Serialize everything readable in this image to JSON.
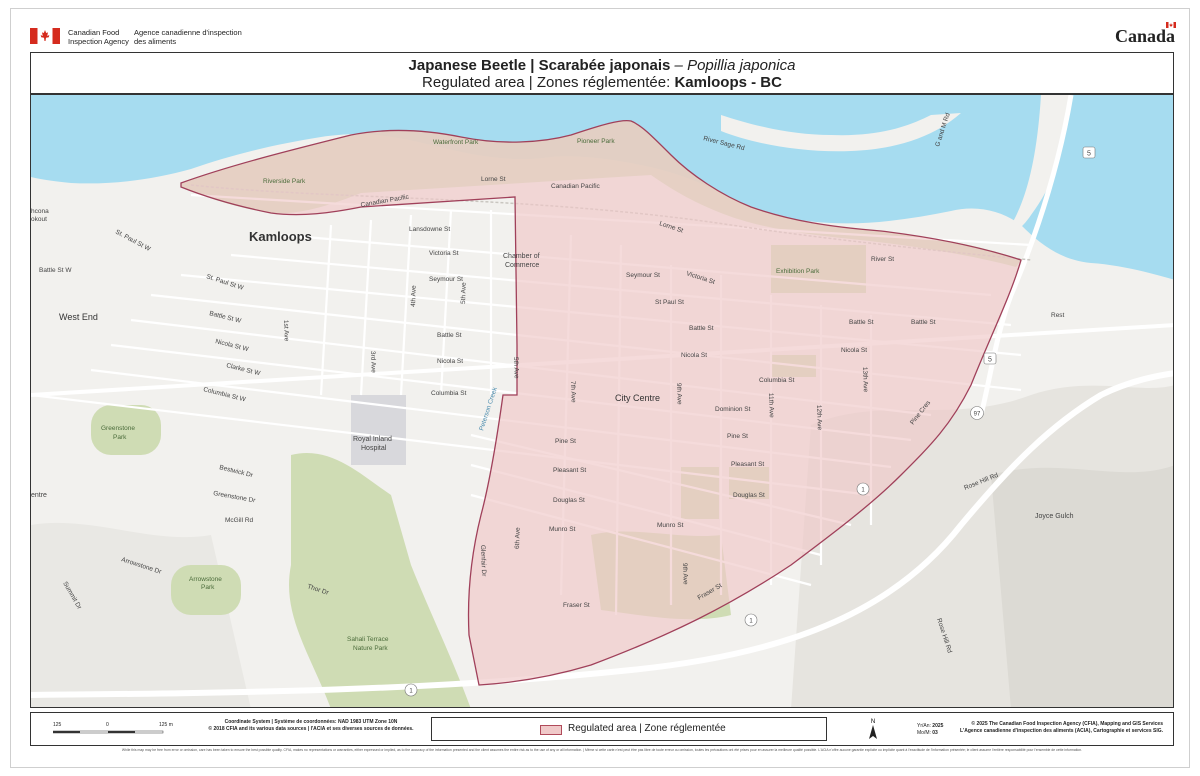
{
  "header": {
    "agency_en": "Canadian Food Inspection Agency",
    "agency_fr": "Agence canadienne d'inspection des aliments",
    "wordmark": "Canada",
    "flag_icon": "canada-flag-icon"
  },
  "title": {
    "common_en": "Japanese Beetle",
    "separator": " | ",
    "common_fr": "Scarabée japonais",
    "dash": " – ",
    "scientific": "Popillia japonica",
    "line2_prefix": "Regulated area | Zones réglementée: ",
    "location": "Kamloops - BC"
  },
  "map": {
    "colors": {
      "water": "#a6dcf0",
      "land": "#f2f1ee",
      "park": "#cfdcb4",
      "regulated_fill": "#f0c8c8",
      "regulated_border": "#a0405a",
      "road": "#ffffff"
    },
    "labels": {
      "city": "Kamloops",
      "west_end": "West End",
      "city_centre": "City Centre",
      "chamber1": "Chamber of",
      "chamber2": "Commerce",
      "hospital1": "Royal Inland",
      "hospital2": "Hospital",
      "joyce": "Joyce Gulch",
      "rest": "Rest",
      "nchcona": "hcona",
      "lookout": "okout",
      "centre_edge": "entre"
    },
    "parks": {
      "riverside": "Riverside Park",
      "waterfront": "Waterfront Park",
      "pioneer": "Pioneer Park",
      "exhibition": "Exhibition Park",
      "greenstone1": "Greenstone",
      "greenstone2": "Park",
      "arrowstone1": "Arrowstone",
      "arrowstone2": "Park",
      "sahali1": "Sahali Terrace",
      "sahali2": "Nature Park"
    },
    "streets": {
      "lorne": "Lorne St",
      "lorne2": "Lorne St",
      "cp1": "Canadian Pacific",
      "cp2": "Canadian Pacific",
      "lansdowne": "Lansdowne St",
      "victoria": "Victoria St",
      "victoria2": "Victoria St",
      "seymour": "Seymour St",
      "seymour2": "Seymour St",
      "stpaul": "St Paul St",
      "stpaul_w": "St. Paul St W",
      "stpaul_w2": "St. Paul St W",
      "battle": "Battle St",
      "battle2": "Battle St",
      "battle3": "Battle St",
      "battle4": "Battle St",
      "battle_w": "Battle St W",
      "battle_w2": "Battle St W",
      "nicola": "Nicola St",
      "nicola2": "Nicola St",
      "nicola3": "Nicola St",
      "nicola_w": "Nicola St W",
      "clarke": "Clarke St W",
      "columbia": "Columbia St",
      "columbia2": "Columbia St",
      "columbia_w": "Columbia St W",
      "dominion": "Dominion St",
      "pine": "Pine St",
      "pine2": "Pine St",
      "pleasant": "Pleasant St",
      "pleasant2": "Pleasant St",
      "douglas": "Douglas St",
      "douglas2": "Douglas St",
      "munro": "Munro St",
      "munro2": "Munro St",
      "fraser": "Fraser St",
      "fraser2": "Fraser St",
      "river_sage": "River Sage Rd",
      "river": "River St",
      "g_m_rd": "G and M Rd",
      "first_ave": "1st Ave",
      "third_ave": "3rd Ave",
      "fourth_ave": "4th Ave",
      "fifth_ave": "5th Ave",
      "fifth_ave2": "5th Ave",
      "sixth_ave": "6th Ave",
      "seventh_ave": "7th Ave",
      "ninth_ave": "9th Ave",
      "ninth_ave2": "9th Ave",
      "eleventh_ave": "11th Ave",
      "twelfth_ave": "12th Ave",
      "thirteenth_ave": "13th Ave",
      "pine_cres": "Pine Cres",
      "peterson": "Peterson Creek",
      "glenfair": "Glenfair Dr",
      "bestwick": "Bestwick Dr",
      "greenstone_dr": "Greenstone Dr",
      "mcgill": "McGill Rd",
      "arrowstone_dr": "Arrowstone Dr",
      "thor": "Thor Dr",
      "summit": "Summit Dr",
      "rose_hill": "Rose Hill Rd",
      "rose_hill2": "Rose Hill Rd"
    },
    "shields": {
      "hwy5a": "5",
      "hwy5b": "5",
      "hwy97": "97",
      "hwy1a": "1",
      "hwy1b": "1",
      "hwy1c": "1"
    }
  },
  "footer": {
    "scale_left": "125",
    "scale_mid": "0",
    "scale_right": "125 m",
    "coord_line1": "Coordinate System | Système de coordonnées: NAD 1983 UTM Zone 10N",
    "coord_line2": "© 2018 CFIA and its various data sources | l'ACIA et ses diverses sources de données.",
    "legend_label": "Regulated area | Zone réglementée",
    "north_label": "N",
    "year_label": "Yr/An:",
    "year_value": "2025",
    "month_label": "Mo/M:",
    "month_value": "03",
    "copyright1": "© 2025  The Canadian Food Inspection Agency (CFIA), Mapping and GIS Services",
    "copyright2": "L'Agence canadienne d'inspection des aliments (ACIA), Cartographie et services SIG.",
    "disclaimer": "While this map may be free from error or omission, care has been taken to ensure the best possible quality. CFIA, makes no representations or warranties, either expressed or implied, as to the accuracy of the information presented and the client assumes the entire risk as to the use of any or all information.  |  Même si cette carte n'est peut être pas libre de toute erreur ou omission, toutes les précautions ont été prises pour en assurer la meilleure qualité possible. L'ACIA n'offre aucune garantie explicite ou implicite quant à l'exactitude de l'information présentée; le client assume l'entière responsabilité pour l'ensemble de cette information."
  }
}
